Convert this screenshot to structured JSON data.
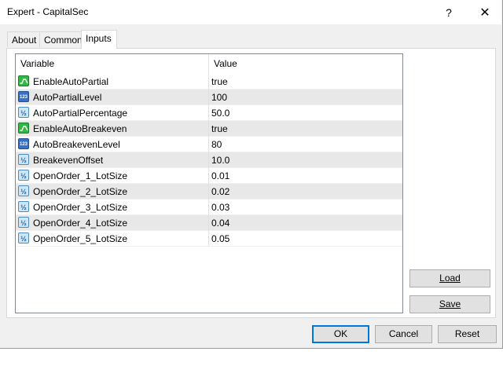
{
  "window": {
    "title": "Expert - CapitalSec",
    "help_glyph": "?",
    "close_glyph": "✕"
  },
  "tabs": [
    {
      "label": "About"
    },
    {
      "label": "Common"
    },
    {
      "label": "Inputs",
      "active": true
    }
  ],
  "grid": {
    "columns": {
      "variable": "Variable",
      "value": "Value"
    },
    "rows": [
      {
        "type": "bool",
        "icon": "bool-icon",
        "variable": "EnableAutoPartial",
        "value": "true"
      },
      {
        "type": "int",
        "icon": "int-icon",
        "variable": "AutoPartialLevel",
        "value": "100"
      },
      {
        "type": "double",
        "icon": "double-icon",
        "variable": "AutoPartialPercentage",
        "value": "50.0"
      },
      {
        "type": "bool",
        "icon": "bool-icon",
        "variable": "EnableAutoBreakeven",
        "value": "true"
      },
      {
        "type": "int",
        "icon": "int-icon",
        "variable": "AutoBreakevenLevel",
        "value": "80"
      },
      {
        "type": "double",
        "icon": "double-icon",
        "variable": "BreakevenOffset",
        "value": "10.0"
      },
      {
        "type": "double",
        "icon": "double-icon",
        "variable": "OpenOrder_1_LotSize",
        "value": "0.01"
      },
      {
        "type": "double",
        "icon": "double-icon",
        "variable": "OpenOrder_2_LotSize",
        "value": "0.02"
      },
      {
        "type": "double",
        "icon": "double-icon",
        "variable": "OpenOrder_3_LotSize",
        "value": "0.03"
      },
      {
        "type": "double",
        "icon": "double-icon",
        "variable": "OpenOrder_4_LotSize",
        "value": "0.04"
      },
      {
        "type": "double",
        "icon": "double-icon",
        "variable": "OpenOrder_5_LotSize",
        "value": "0.05"
      }
    ]
  },
  "buttons": {
    "load": "Load",
    "save": "Save",
    "ok": "OK",
    "cancel": "Cancel",
    "reset": "Reset"
  },
  "colors": {
    "ok_focus_border": "#0078d7",
    "row_alt": "#e8e8e8",
    "bool_icon": "#2fb842",
    "int_icon": "#3670c8",
    "double_icon": "#cfe6f7"
  }
}
